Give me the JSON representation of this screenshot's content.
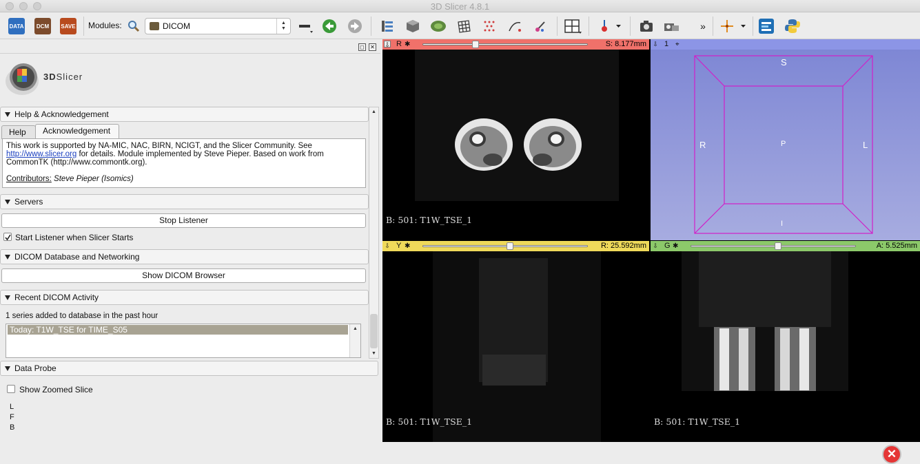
{
  "window": {
    "title": "3D Slicer 4.8.1"
  },
  "toolbar": {
    "modules_label": "Modules:",
    "current_module": "DICOM",
    "data_label": "DATA",
    "dcm_label": "DCM",
    "save_label": "SAVE",
    "more_label": "»"
  },
  "logo": {
    "text_bold": "3D",
    "text_rest": "Slicer"
  },
  "help": {
    "header": "Help & Acknowledgement",
    "tabs": [
      "Help",
      "Acknowledgement"
    ],
    "active_tab": "Acknowledgement",
    "text_before_link": "This work is supported by NA-MIC, NAC, BIRN, NCIGT, and the Slicer Community. See ",
    "link": "http://www.slicer.org",
    "text_after_link": " for details. Module implemented by Steve Pieper. Based on work from CommonTK (http://www.commontk.org).",
    "contributors_label": "Contributors:",
    "contributors": "Steve Pieper (Isomics)"
  },
  "servers": {
    "header": "Servers",
    "stop_listener": "Stop Listener",
    "start_listener_label": "Start Listener when Slicer Starts",
    "start_listener_checked": true
  },
  "dicom_db": {
    "header": "DICOM Database and Networking",
    "show_browser": "Show DICOM Browser"
  },
  "recent": {
    "header": "Recent DICOM Activity",
    "summary": "1 series added to database in the past hour",
    "items": [
      "Today: T1W_TSE for TIME_S05"
    ]
  },
  "probe": {
    "header": "Data Probe",
    "show_zoomed_label": "Show Zoomed Slice",
    "show_zoomed_checked": false,
    "lines": [
      "L",
      "F",
      "B"
    ]
  },
  "views": {
    "red": {
      "letter": "R",
      "offset": "S: 8.177mm",
      "slider_fraction": 0.31,
      "label": "B: 501: T1W_TSE_1",
      "color": "#f0716a"
    },
    "yellow": {
      "letter": "Y",
      "offset": "R: 25.592mm",
      "slider_fraction": 0.53,
      "label": "B: 501: T1W_TSE_1",
      "color": "#efd95a"
    },
    "green": {
      "letter": "G",
      "offset": "A: 5.525mm",
      "slider_fraction": 0.53,
      "label": "B: 501: T1W_TSE_1",
      "color": "#8cc96a"
    },
    "threed": {
      "number": "1",
      "color": "#8c95e6",
      "axes": {
        "top": "S",
        "left": "R",
        "center": "P",
        "right": "L",
        "bottom": "I"
      }
    }
  }
}
